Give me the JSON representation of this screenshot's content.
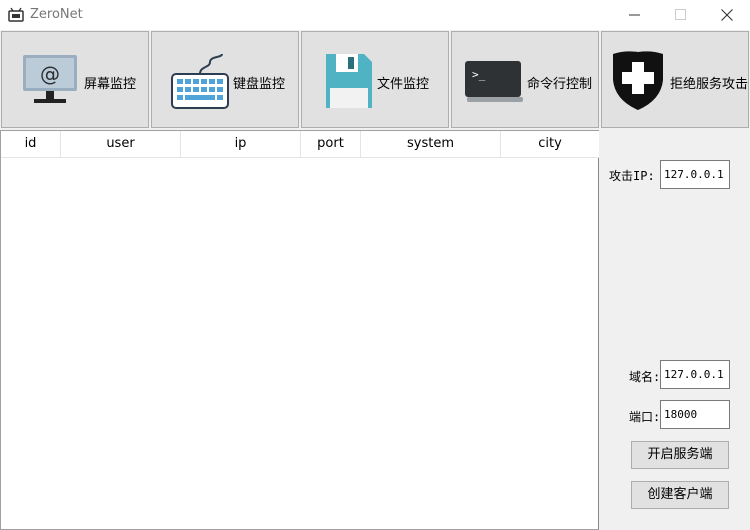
{
  "window": {
    "title": "ZeroNet"
  },
  "toolbar": {
    "buttons": [
      {
        "label": "屏幕监控",
        "icon": "monitor-icon"
      },
      {
        "label": "键盘监控",
        "icon": "keyboard-icon"
      },
      {
        "label": "文件监控",
        "icon": "floppy-disk-icon"
      },
      {
        "label": "命令行控制",
        "icon": "terminal-icon"
      },
      {
        "label": "拒绝服务攻击",
        "icon": "shield-plus-icon"
      }
    ]
  },
  "table": {
    "columns": [
      "id",
      "user",
      "ip",
      "port",
      "system",
      "city"
    ],
    "rows": []
  },
  "side": {
    "attack_ip_label": "攻击IP:",
    "attack_ip_value": "127.0.0.1",
    "domain_label": "域名:",
    "domain_value": "127.0.0.1",
    "port_label": "端口:",
    "port_value": "18000",
    "start_server_label": "开启服务端",
    "create_client_label": "创建客户端"
  }
}
